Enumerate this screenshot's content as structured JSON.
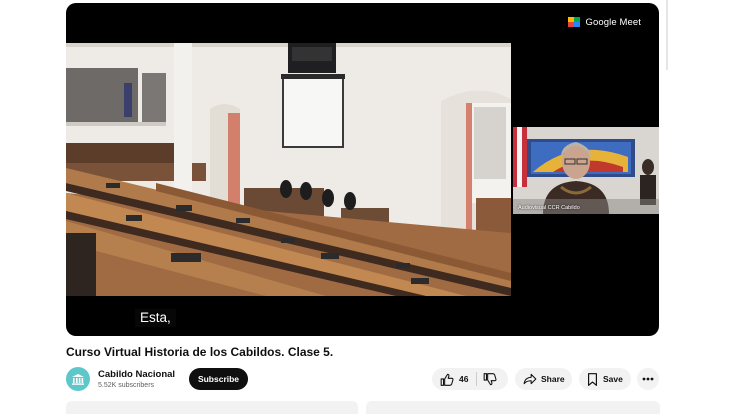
{
  "player": {
    "meet_label": "Google Meet",
    "presenter_name": "Audiovisual CCR Cabildo",
    "caption": "Esta,"
  },
  "video": {
    "title": "Curso Virtual Historia de los Cabildos. Clase 5."
  },
  "channel": {
    "name": "Cabildo Nacional",
    "subscribers": "5.52K subscribers",
    "avatar_icon": "building-icon",
    "avatar_color": "#5ec7c9"
  },
  "actions": {
    "subscribe_label": "Subscribe",
    "like_count": "46",
    "share_label": "Share",
    "save_label": "Save"
  }
}
